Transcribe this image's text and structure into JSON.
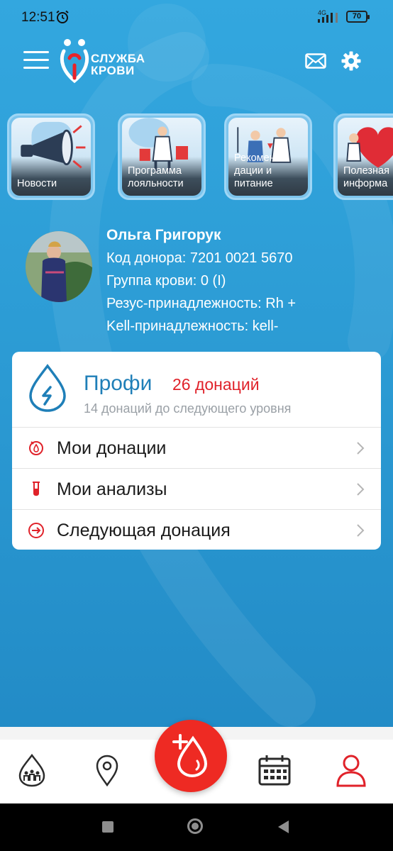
{
  "status_bar": {
    "time": "12:51",
    "network": "4G",
    "battery": "70"
  },
  "header": {
    "logo_line1": "СЛУЖБА",
    "logo_line2": "КРОВИ",
    "icons": [
      "menu-icon",
      "mail-icon",
      "gear-icon"
    ]
  },
  "stories": [
    {
      "label": "Новости",
      "icon": "megaphone"
    },
    {
      "label": "Программа лояльности",
      "icon": "shopping-people"
    },
    {
      "label": "Рекомен дации и питание",
      "icon": "doctors"
    },
    {
      "label": "Полезная информа",
      "icon": "heart"
    }
  ],
  "profile": {
    "name": "Ольга Григорук",
    "donor_code": "Код донора: 7201 0021 5670",
    "blood_group": "Группа крови: 0 (I)",
    "rhesus": "Резус-принадлежность: Rh +",
    "kell": "Kell-принадлежность: kell-"
  },
  "level": {
    "name": "Профи",
    "donations": "26 донаций",
    "next": "14 донаций  до следующего уровня"
  },
  "menu": [
    {
      "label": "Мои донации",
      "icon": "donation-icon"
    },
    {
      "label": "Мои анализы",
      "icon": "test-tube-icon"
    },
    {
      "label": "Следующая донация",
      "icon": "next-donation-icon"
    }
  ],
  "bottom_nav": [
    "community-icon",
    "location-pin-icon",
    "add-donation-icon",
    "calendar-icon",
    "profile-icon"
  ],
  "colors": {
    "background": "#2b9ad3",
    "accent_red": "#ee2a23",
    "level_blue": "#1f7fb8"
  }
}
